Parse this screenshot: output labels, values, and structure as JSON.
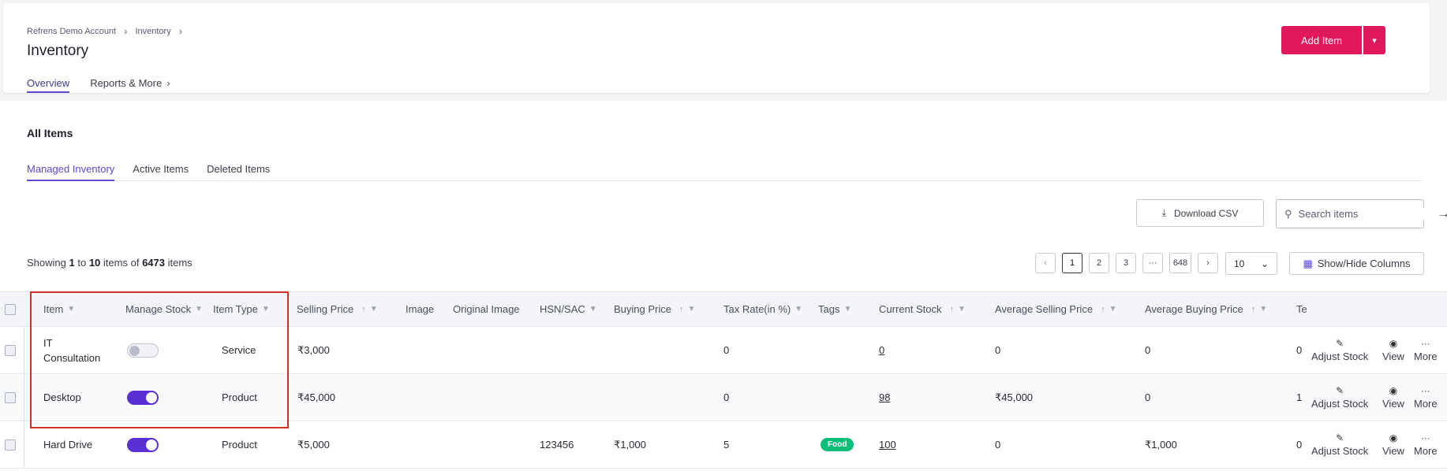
{
  "breadcrumb": [
    "Refrens Demo Account",
    "Inventory"
  ],
  "page_title": "Inventory",
  "top_tabs": [
    {
      "label": "Overview",
      "active": true
    },
    {
      "label": "Reports & More",
      "active": false
    }
  ],
  "add_item_label": "Add Item",
  "section_title": "All Items",
  "sub_tabs": [
    {
      "label": "Managed Inventory",
      "active": true
    },
    {
      "label": "Active Items"
    },
    {
      "label": "Deleted Items"
    }
  ],
  "download_csv_label": "Download CSV",
  "search_placeholder": "Search items",
  "showing": {
    "prefix": "Showing",
    "from": "1",
    "to_word": "to",
    "to": "10",
    "items_of": "items of",
    "total": "6473",
    "suffix": "items"
  },
  "pagination": {
    "pages": [
      "1",
      "2",
      "3",
      "···",
      "648"
    ],
    "active": "1"
  },
  "per_page": "10",
  "show_hide_label": "Show/Hide Columns",
  "columns": [
    "Item",
    "Manage Stock",
    "Item Type",
    "Selling Price",
    "Image",
    "Original Image",
    "HSN/SAC",
    "Buying Price",
    "Tax Rate(in %)",
    "Tags",
    "Current Stock",
    "Average Selling Price",
    "Average Buying Price",
    "Te"
  ],
  "rows": [
    {
      "item_line1": "IT",
      "item_line2": "Consultation",
      "manage_stock": false,
      "item_type": "Service",
      "selling_price": "₹3,000",
      "hsn": "",
      "buying_price": "",
      "tax_rate": "0",
      "tag": "",
      "current_stock": "0",
      "avg_selling": "0",
      "avg_buying": "0",
      "te": "0"
    },
    {
      "item_line1": "Desktop",
      "item_line2": "",
      "manage_stock": true,
      "item_type": "Product",
      "selling_price": "₹45,000",
      "hsn": "",
      "buying_price": "",
      "tax_rate": "0",
      "tag": "",
      "current_stock": "98",
      "avg_selling": "₹45,000",
      "avg_buying": "0",
      "te": "1"
    },
    {
      "item_line1": "Hard Drive",
      "item_line2": "",
      "manage_stock": true,
      "item_type": "Product",
      "selling_price": "₹5,000",
      "hsn": "123456",
      "buying_price": "₹1,000",
      "tax_rate": "5",
      "tag": "Food",
      "current_stock": "100",
      "avg_selling": "0",
      "avg_buying": "₹1,000",
      "te": "0"
    }
  ],
  "actions": {
    "adjust": "Adjust Stock",
    "view": "View",
    "more": "More"
  },
  "colors": {
    "accent": "#5a4bd1",
    "brand": "#e0195c",
    "toggle_on": "#5b2fd6",
    "tag_food": "#0bbf7a",
    "highlight": "#d3301f"
  }
}
